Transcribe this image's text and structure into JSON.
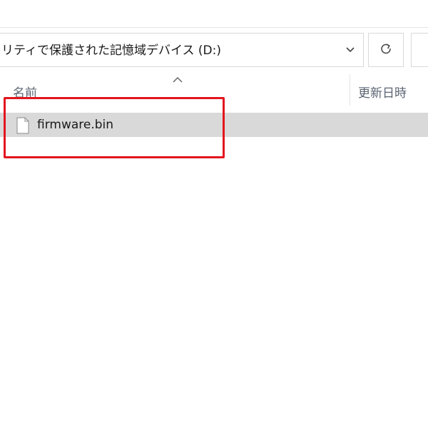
{
  "address_bar": {
    "path_text": "リティで保護された記憶域デバイス (D:)",
    "dropdown_icon": "chevron-down-icon"
  },
  "toolbar": {
    "refresh_icon": "refresh-icon"
  },
  "column_header": {
    "name_label": "名前",
    "date_label": "更新日時",
    "sort_icon": "sort-up-icon"
  },
  "files": [
    {
      "name": "firmware.bin",
      "icon": "file-icon",
      "selected": true
    }
  ],
  "colors": {
    "highlight": "#e3151f",
    "selected_row": "#d9d9d9"
  }
}
